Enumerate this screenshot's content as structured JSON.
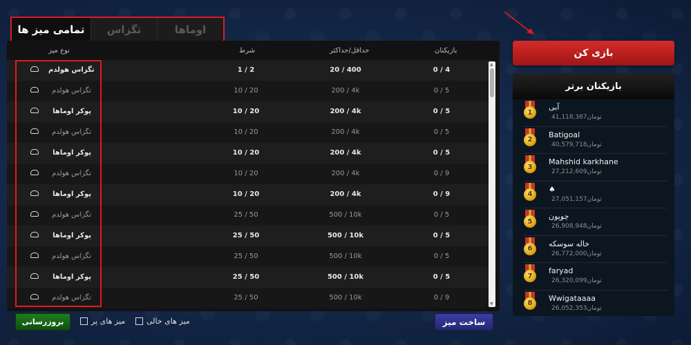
{
  "tabs": [
    {
      "label": "تمامی میز ها",
      "active": true
    },
    {
      "label": "تگزاس",
      "active": false
    },
    {
      "label": "اوماها",
      "active": false
    }
  ],
  "table": {
    "headers": {
      "type": "نوع میز",
      "blind": "شرط",
      "minmax": "حداقل/حداکثر",
      "players": "بازیکنان"
    },
    "rows": [
      {
        "name": "تگزاس هولدم",
        "blind": "1 / 2",
        "minmax": "20 / 400",
        "players": "0 / 4"
      },
      {
        "name": "تگزاس هولدم",
        "blind": "10 / 20",
        "minmax": "200 / 4k",
        "players": "0 / 5"
      },
      {
        "name": "پوکر اوماها",
        "blind": "10 / 20",
        "minmax": "200 / 4k",
        "players": "0 / 5"
      },
      {
        "name": "تگزاس هولدم",
        "blind": "10 / 20",
        "minmax": "200 / 4k",
        "players": "0 / 5"
      },
      {
        "name": "پوکر اوماها",
        "blind": "10 / 20",
        "minmax": "200 / 4k",
        "players": "0 / 5"
      },
      {
        "name": "تگزاس هولدم",
        "blind": "10 / 20",
        "minmax": "200 / 4k",
        "players": "0 / 9"
      },
      {
        "name": "پوکر اوماها",
        "blind": "10 / 20",
        "minmax": "200 / 4k",
        "players": "0 / 9"
      },
      {
        "name": "تگزاس هولدم",
        "blind": "25 / 50",
        "minmax": "500 / 10k",
        "players": "0 / 5"
      },
      {
        "name": "پوکر اوماها",
        "blind": "25 / 50",
        "minmax": "500 / 10k",
        "players": "0 / 5"
      },
      {
        "name": "تگزاس هولدم",
        "blind": "25 / 50",
        "minmax": "500 / 10k",
        "players": "0 / 5"
      },
      {
        "name": "پوکر اوماها",
        "blind": "25 / 50",
        "minmax": "500 / 10k",
        "players": "0 / 5"
      },
      {
        "name": "تگزاس هولدم",
        "blind": "25 / 50",
        "minmax": "500 / 10k",
        "players": "0 / 9"
      }
    ]
  },
  "bottom": {
    "refresh_label": "بروزرسانی",
    "full_tables_label": "میز های پر",
    "empty_tables_label": "میز های خالی",
    "create_label": "ساخت میز"
  },
  "play_label": "بازی کن",
  "leaderboard": {
    "title": "بازیکنان برتر",
    "currency": "تومان",
    "items": [
      {
        "rank": "1",
        "name": "آبی",
        "amount": "41,118,367"
      },
      {
        "rank": "2",
        "name": "Batigoal",
        "amount": "40,579,718"
      },
      {
        "rank": "3",
        "name": "Mahshid karkhane",
        "amount": "27,212,609"
      },
      {
        "rank": "4",
        "name": "♠",
        "amount": "27,051,157"
      },
      {
        "rank": "5",
        "name": "چوپون",
        "amount": "26,908,948"
      },
      {
        "rank": "6",
        "name": "خاله سوسکه",
        "amount": "26,772,000"
      },
      {
        "rank": "7",
        "name": "faryad",
        "amount": "26,320,099"
      },
      {
        "rank": "8",
        "name": "Wwigataaaa",
        "amount": "26,052,353"
      }
    ]
  }
}
